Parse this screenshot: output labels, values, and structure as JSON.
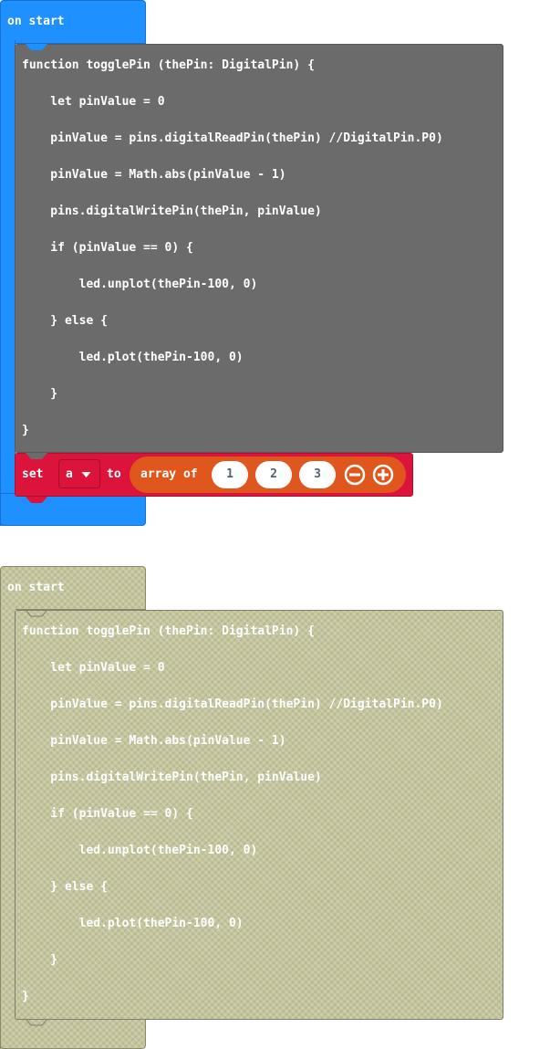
{
  "colors": {
    "events": "#1e90ff",
    "functions": "#6b6b6b",
    "variables": "#dc143c",
    "arrays": "#e0571e",
    "disabled": "#c4c49e"
  },
  "stack1": {
    "event_label": "on start",
    "code_lines": [
      "function togglePin (thePin: DigitalPin) {",
      "    let pinValue = 0",
      "    pinValue = pins.digitalReadPin(thePin) //DigitalPin.P0)",
      "    pinValue = Math.abs(pinValue - 1)",
      "    pins.digitalWritePin(thePin, pinValue)",
      "    if (pinValue == 0) {",
      "        led.unplot(thePin-100, 0)",
      "    } else {",
      "        led.plot(thePin-100, 0)",
      "    }",
      "}"
    ],
    "set_block": {
      "set_label": "set",
      "variable": "a",
      "to_label": "to",
      "array_label": "array of",
      "values": [
        "1",
        "2",
        "3"
      ],
      "remove_icon": "minus-circle-icon",
      "add_icon": "plus-circle-icon"
    }
  },
  "stack2": {
    "event_label": "on start",
    "code_lines": [
      "function togglePin (thePin: DigitalPin) {",
      "    let pinValue = 0",
      "    pinValue = pins.digitalReadPin(thePin) //DigitalPin.P0)",
      "    pinValue = Math.abs(pinValue - 1)",
      "    pins.digitalWritePin(thePin, pinValue)",
      "    if (pinValue == 0) {",
      "        led.unplot(thePin-100, 0)",
      "    } else {",
      "        led.plot(thePin-100, 0)",
      "    }",
      "}"
    ]
  }
}
